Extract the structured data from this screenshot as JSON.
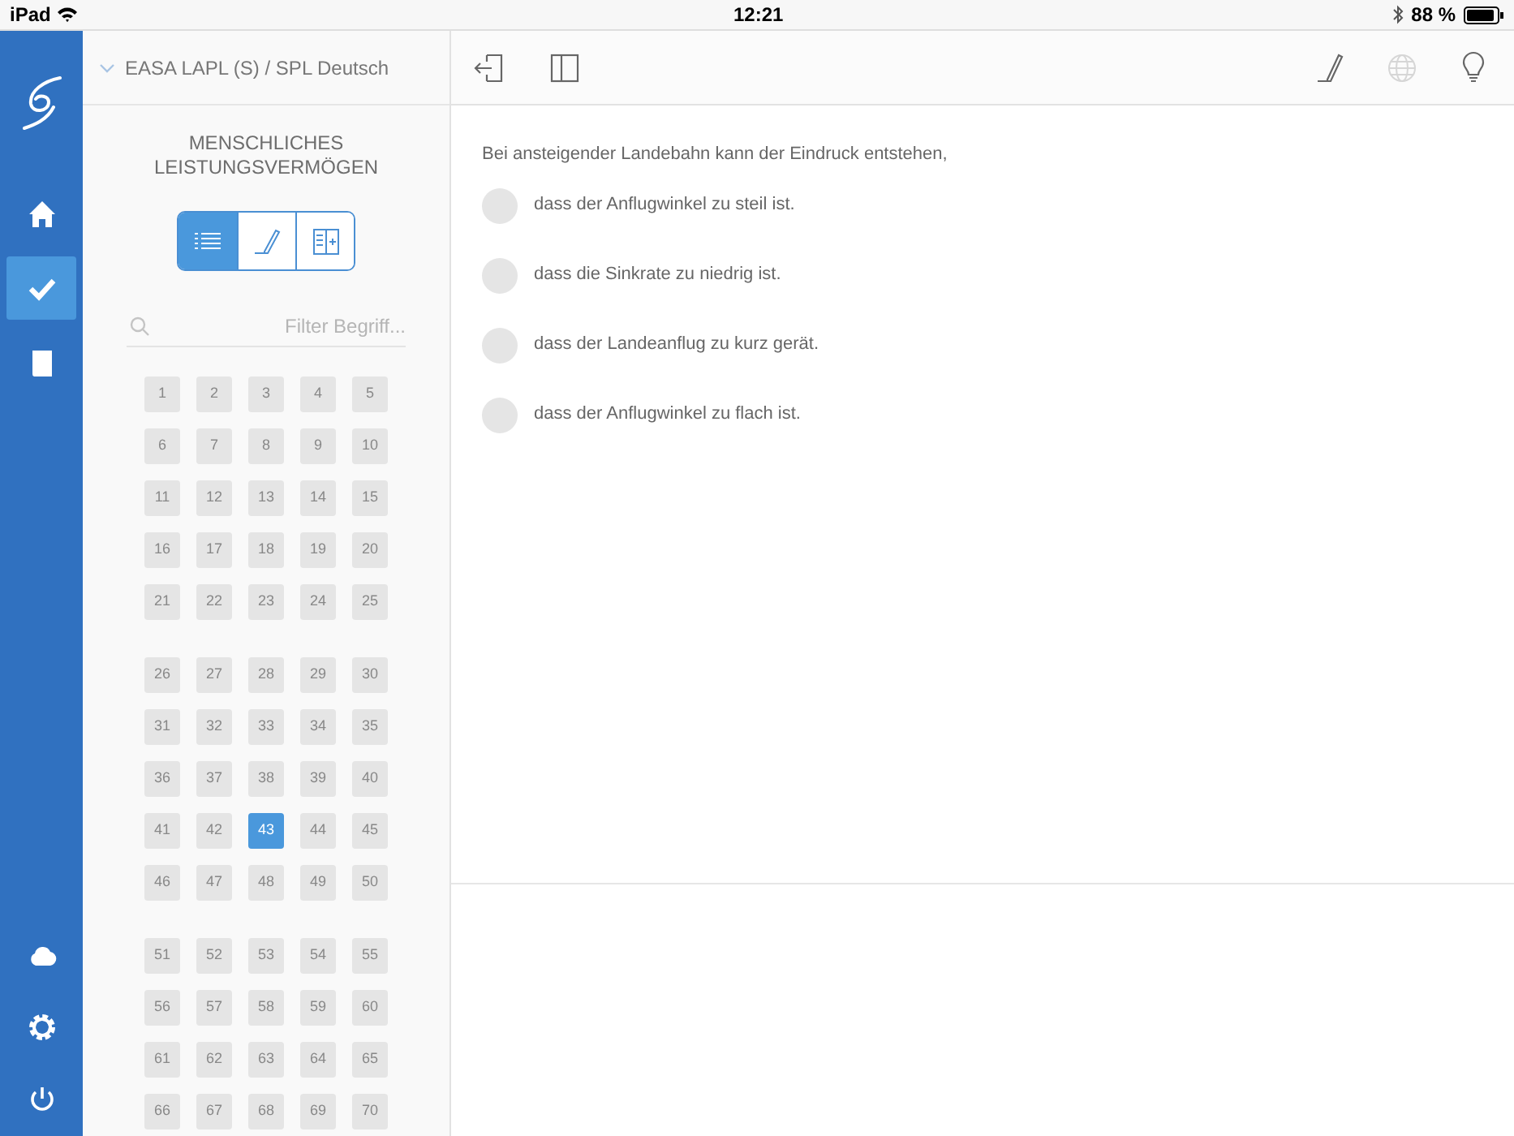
{
  "status_bar": {
    "device": "iPad",
    "time": "12:21",
    "battery": "88 %"
  },
  "rail": {
    "top": [
      {
        "kind": "home",
        "selected": false
      },
      {
        "kind": "check",
        "selected": true
      },
      {
        "kind": "book",
        "selected": false
      }
    ],
    "bottom": [
      {
        "kind": "cloud",
        "selected": false
      },
      {
        "kind": "settings",
        "selected": false
      },
      {
        "kind": "power",
        "selected": false
      }
    ]
  },
  "sidebar": {
    "course": "EASA LAPL (S) / SPL Deutsch",
    "subject": "MENSCHLICHES LEISTUNGSVERMÖGEN",
    "view_modes": [
      {
        "kind": "list",
        "selected": true
      },
      {
        "kind": "pen",
        "selected": false
      },
      {
        "kind": "split",
        "selected": false
      }
    ],
    "filter": {
      "placeholder": "Filter Begriff..."
    },
    "question_groups": [
      [
        {
          "label": "1",
          "selected": false
        },
        {
          "label": "2",
          "selected": false
        },
        {
          "label": "3",
          "selected": false
        },
        {
          "label": "4",
          "selected": false
        },
        {
          "label": "5",
          "selected": false
        },
        {
          "label": "6",
          "selected": false
        },
        {
          "label": "7",
          "selected": false
        },
        {
          "label": "8",
          "selected": false
        },
        {
          "label": "9",
          "selected": false
        },
        {
          "label": "10",
          "selected": false
        },
        {
          "label": "11",
          "selected": false
        },
        {
          "label": "12",
          "selected": false
        },
        {
          "label": "13",
          "selected": false
        },
        {
          "label": "14",
          "selected": false
        },
        {
          "label": "15",
          "selected": false
        },
        {
          "label": "16",
          "selected": false
        },
        {
          "label": "17",
          "selected": false
        },
        {
          "label": "18",
          "selected": false
        },
        {
          "label": "19",
          "selected": false
        },
        {
          "label": "20",
          "selected": false
        },
        {
          "label": "21",
          "selected": false
        },
        {
          "label": "22",
          "selected": false
        },
        {
          "label": "23",
          "selected": false
        },
        {
          "label": "24",
          "selected": false
        },
        {
          "label": "25",
          "selected": false
        }
      ],
      [
        {
          "label": "26",
          "selected": false
        },
        {
          "label": "27",
          "selected": false
        },
        {
          "label": "28",
          "selected": false
        },
        {
          "label": "29",
          "selected": false
        },
        {
          "label": "30",
          "selected": false
        },
        {
          "label": "31",
          "selected": false
        },
        {
          "label": "32",
          "selected": false
        },
        {
          "label": "33",
          "selected": false
        },
        {
          "label": "34",
          "selected": false
        },
        {
          "label": "35",
          "selected": false
        },
        {
          "label": "36",
          "selected": false
        },
        {
          "label": "37",
          "selected": false
        },
        {
          "label": "38",
          "selected": false
        },
        {
          "label": "39",
          "selected": false
        },
        {
          "label": "40",
          "selected": false
        },
        {
          "label": "41",
          "selected": false
        },
        {
          "label": "42",
          "selected": false
        },
        {
          "label": "43",
          "selected": true
        },
        {
          "label": "44",
          "selected": false
        },
        {
          "label": "45",
          "selected": false
        },
        {
          "label": "46",
          "selected": false
        },
        {
          "label": "47",
          "selected": false
        },
        {
          "label": "48",
          "selected": false
        },
        {
          "label": "49",
          "selected": false
        },
        {
          "label": "50",
          "selected": false
        }
      ],
      [
        {
          "label": "51",
          "selected": false
        },
        {
          "label": "52",
          "selected": false
        },
        {
          "label": "53",
          "selected": false
        },
        {
          "label": "54",
          "selected": false
        },
        {
          "label": "55",
          "selected": false
        },
        {
          "label": "56",
          "selected": false
        },
        {
          "label": "57",
          "selected": false
        },
        {
          "label": "58",
          "selected": false
        },
        {
          "label": "59",
          "selected": false
        },
        {
          "label": "60",
          "selected": false
        },
        {
          "label": "61",
          "selected": false
        },
        {
          "label": "62",
          "selected": false
        },
        {
          "label": "63",
          "selected": false
        },
        {
          "label": "64",
          "selected": false
        },
        {
          "label": "65",
          "selected": false
        },
        {
          "label": "66",
          "selected": false
        },
        {
          "label": "67",
          "selected": false
        },
        {
          "label": "68",
          "selected": false
        },
        {
          "label": "69",
          "selected": false
        },
        {
          "label": "70",
          "selected": false
        }
      ]
    ]
  },
  "toolbar": {
    "left": [
      {
        "kind": "exit",
        "disabled": false
      },
      {
        "kind": "panel",
        "disabled": false
      }
    ],
    "right": [
      {
        "kind": "pen",
        "disabled": false
      },
      {
        "kind": "globe",
        "disabled": true
      },
      {
        "kind": "bulb",
        "disabled": false
      }
    ]
  },
  "question": {
    "text": "Bei ansteigender Landebahn kann der Eindruck entstehen,",
    "answers": [
      {
        "text": "dass der Anflugwinkel zu steil ist.",
        "selected": false
      },
      {
        "text": "dass die Sinkrate zu niedrig ist.",
        "selected": false
      },
      {
        "text": "dass der Landeanflug zu kurz gerät.",
        "selected": false
      },
      {
        "text": "dass der Anflugwinkel zu flach ist.",
        "selected": false
      }
    ]
  }
}
